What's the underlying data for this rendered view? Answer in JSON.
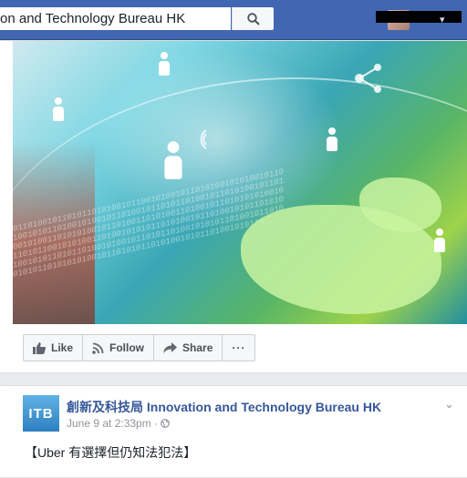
{
  "header": {
    "search_value": "on and Technology Bureau HK"
  },
  "post1": {
    "actions": [
      {
        "label": "Like",
        "icon": "thumbs-up-icon"
      },
      {
        "label": "Follow",
        "icon": "rss-icon"
      },
      {
        "label": "Share",
        "icon": "share-arrow-icon"
      },
      {
        "label": "···",
        "icon": "more-icon"
      }
    ]
  },
  "post2": {
    "page_name": "創新及科技局 Innovation and Technology Bureau HK",
    "logo_text": "ITB",
    "timestamp": "June 9 at 2:33pm",
    "separator": "·",
    "text": "【Uber 有選擇但仍知法犯法】"
  },
  "colors": {
    "brand_blue": "#4267b2",
    "link_blue": "#365899"
  }
}
